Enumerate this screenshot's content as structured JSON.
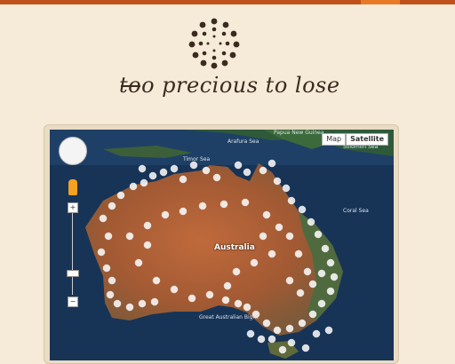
{
  "brand": {
    "tagline": "too precious to lose"
  },
  "map": {
    "type_buttons": {
      "map": "Map",
      "satellite": "Satellite"
    },
    "zoom": {
      "in": "+",
      "out": "−"
    },
    "labels": {
      "papua_new_guinea": "Papua New Guinea",
      "arafura_sea": "Arafura Sea",
      "timor_sea": "Timor Sea",
      "coral_sea": "Coral Sea",
      "solomon_sea": "Solomon Sea",
      "australia": "Australia",
      "great_australian_bight": "Great Australian Bight"
    }
  },
  "colors": {
    "accent": "#c2501a",
    "accent_tab": "#e87a26",
    "logo": "#3b2a1f",
    "background": "#f5ebd8"
  }
}
